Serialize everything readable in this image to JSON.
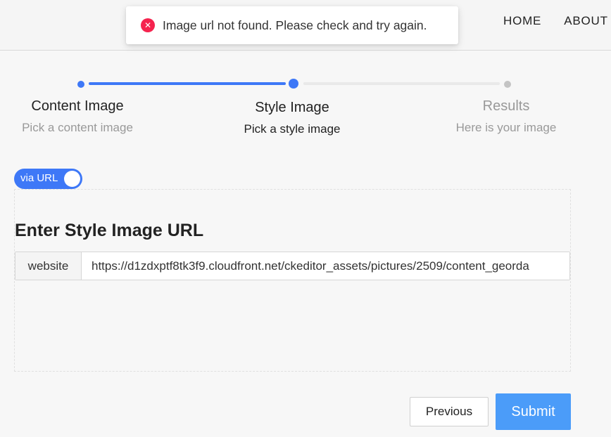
{
  "header": {
    "nav": [
      {
        "label": "HOME"
      },
      {
        "label": "ABOUT"
      }
    ]
  },
  "toast": {
    "icon": "close-circle-icon",
    "message": "Image url not found. Please check and try again.",
    "color": "#f5234e"
  },
  "stepper": {
    "accent_color": "#3e78f7",
    "current_step": 2,
    "steps": [
      {
        "title": "Content Image",
        "subtitle": "Pick a content image",
        "status": "done"
      },
      {
        "title": "Style Image",
        "subtitle": "Pick a style image",
        "status": "active"
      },
      {
        "title": "Results",
        "subtitle": "Here is your image",
        "status": "pending"
      }
    ]
  },
  "toggle": {
    "label": "via URL",
    "checked": true
  },
  "form": {
    "title": "Enter Style Image URL",
    "addon": "website",
    "url_value": "https://d1zdxptf8tk3f9.cloudfront.net/ckeditor_assets/pictures/2509/content_georda"
  },
  "actions": {
    "previous": "Previous",
    "submit": "Submit",
    "submit_color": "#4b9cf9"
  }
}
